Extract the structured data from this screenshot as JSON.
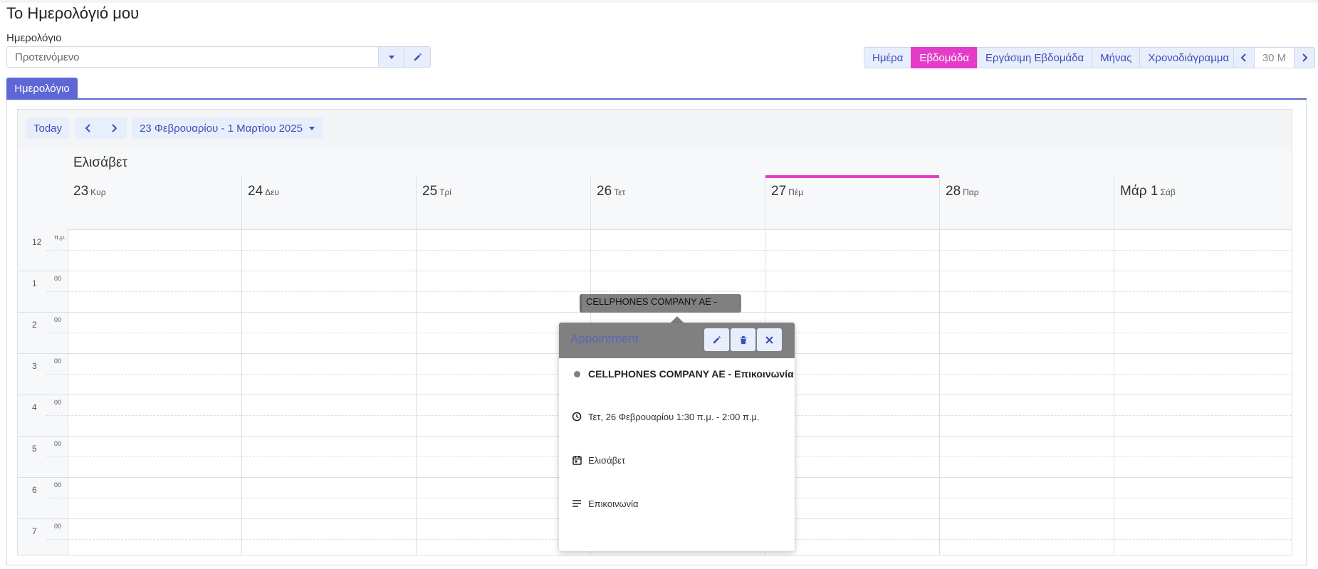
{
  "page": {
    "title": "Το Ημερολόγιό μου"
  },
  "calendar_field": {
    "label": "Ημερολόγιο",
    "placeholder": "Προτεινόμενο"
  },
  "views": [
    {
      "label": "Ημέρα",
      "active": false
    },
    {
      "label": "Εβδομάδα",
      "active": true
    },
    {
      "label": "Εργάσιμη Εβδομάδα",
      "active": false
    },
    {
      "label": "Μήνας",
      "active": false
    },
    {
      "label": "Χρονοδιάγραμμα",
      "active": false
    }
  ],
  "scale": {
    "value": "30 M"
  },
  "tab": {
    "label": "Ημερολόγιο"
  },
  "toolbar": {
    "today_label": "Today",
    "date_range": "23 Φεβρουαρίου - 1 Μαρτίου 2025"
  },
  "resource": {
    "name": "Ελισάβετ"
  },
  "days": [
    {
      "num": "23",
      "weekday": "Κυρ",
      "today": false
    },
    {
      "num": "24",
      "weekday": "Δευ",
      "today": false
    },
    {
      "num": "25",
      "weekday": "Τρί",
      "today": false
    },
    {
      "num": "26",
      "weekday": "Τετ",
      "today": false
    },
    {
      "num": "27",
      "weekday": "Πέμ",
      "today": true
    },
    {
      "num": "28",
      "weekday": "Παρ",
      "today": false
    },
    {
      "num": "Μάρ 1",
      "weekday": "Σάβ",
      "today": false
    }
  ],
  "hours": [
    {
      "label": "12",
      "minutes": "π.μ."
    },
    {
      "label": "1",
      "minutes": "00"
    },
    {
      "label": "2",
      "minutes": "00"
    },
    {
      "label": "3",
      "minutes": "00"
    },
    {
      "label": "4",
      "minutes": "00"
    },
    {
      "label": "5",
      "minutes": "00"
    },
    {
      "label": "6",
      "minutes": "00"
    },
    {
      "label": "7",
      "minutes": "00"
    }
  ],
  "event": {
    "title": "CELLPHONES COMPANY AE -",
    "color": "#808080"
  },
  "popover": {
    "header": "Appointment",
    "subject": "CELLPHONES COMPANY AE - Επικοινωνία",
    "time": "Τετ, 26 Φεβρουαρίου 1:30 π.μ. - 2:00 π.μ.",
    "calendar": "Ελισάβετ",
    "description": "Επικοινωνία",
    "icons": [
      "pencil-icon",
      "trash-icon",
      "close-icon",
      "clock-icon",
      "calendar-icon",
      "lines-icon"
    ]
  },
  "colors": {
    "accent": "#e43cc9",
    "primary": "#5f67d6",
    "button_bg": "#e8eefb",
    "button_text": "#3d50b8",
    "event_gray": "#808080"
  }
}
